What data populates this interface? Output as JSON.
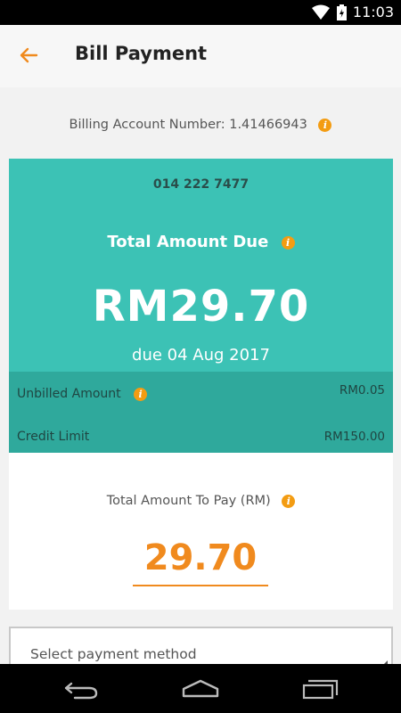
{
  "status_bar": {
    "time": "11:03",
    "icons": [
      "wifi-icon",
      "battery-icon"
    ]
  },
  "header": {
    "title": "Bill Payment",
    "back_icon": "arrow-left-icon"
  },
  "account": {
    "label": "Billing Account Number: 1.41466943"
  },
  "summary": {
    "phone_number": "014 222 7477",
    "total_due_label": "Total Amount Due",
    "total_due_amount": "RM29.70",
    "due_date": "due 04 Aug 2017",
    "unbilled_label": "Unbilled Amount",
    "unbilled_value": "RM0.05",
    "credit_limit_label": "Credit Limit",
    "credit_limit_value": "RM150.00"
  },
  "payment": {
    "label": "Total Amount To Pay (RM)",
    "amount": "29.70"
  },
  "payment_method": {
    "placeholder": "Select payment method"
  },
  "info_glyph": "i",
  "colors": {
    "accent": "#f08a1e",
    "teal": "#3cc2b5",
    "teal_dark": "#2fa99c",
    "info": "#f39c12"
  },
  "nav_bar": {
    "icons": [
      "back-nav-icon",
      "home-nav-icon",
      "recents-nav-icon"
    ]
  }
}
